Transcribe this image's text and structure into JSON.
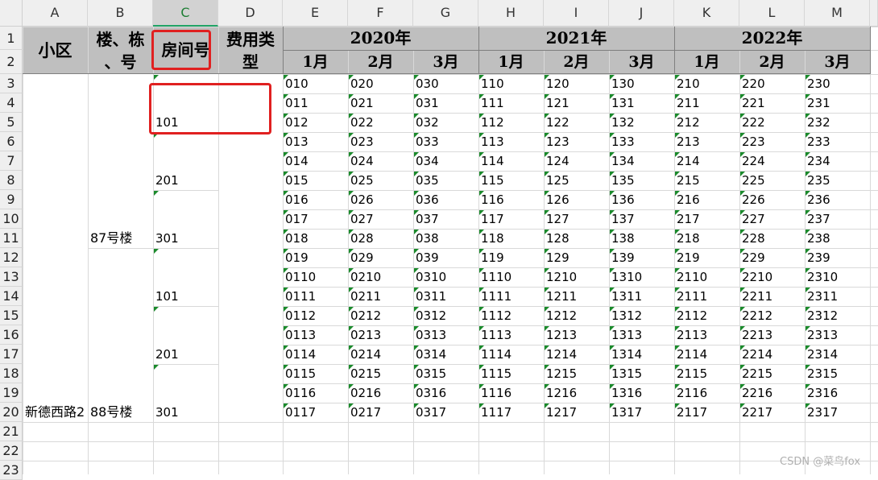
{
  "columns": [
    "A",
    "B",
    "C",
    "D",
    "E",
    "F",
    "G",
    "H",
    "I",
    "J",
    "K",
    "L",
    "M"
  ],
  "selected_column": "C",
  "rows": [
    "1",
    "2",
    "3",
    "4",
    "5",
    "6",
    "7",
    "8",
    "9",
    "10",
    "11",
    "12",
    "13",
    "14",
    "15",
    "16",
    "17",
    "18",
    "19",
    "20",
    "21",
    "22",
    "23"
  ],
  "header": {
    "community": "小区",
    "building_line1": "楼、栋",
    "building_line2": "、号",
    "room": "房间号",
    "fee_line1": "费用类",
    "fee_line2": "型",
    "years": [
      "2020年",
      "2021年",
      "2022年"
    ],
    "months": [
      "1月",
      "2月",
      "3月",
      "1月",
      "2月",
      "3月",
      "1月",
      "2月",
      "3月"
    ]
  },
  "side": {
    "community_value": "新德西路2",
    "buildings": [
      "87号楼",
      "88号楼"
    ],
    "rooms": [
      "101",
      "201",
      "301",
      "101",
      "201",
      "301"
    ]
  },
  "data": [
    [
      "010",
      "020",
      "030",
      "110",
      "120",
      "130",
      "210",
      "220",
      "230"
    ],
    [
      "011",
      "021",
      "031",
      "111",
      "121",
      "131",
      "211",
      "221",
      "231"
    ],
    [
      "012",
      "022",
      "032",
      "112",
      "122",
      "132",
      "212",
      "222",
      "232"
    ],
    [
      "013",
      "023",
      "033",
      "113",
      "123",
      "133",
      "213",
      "223",
      "233"
    ],
    [
      "014",
      "024",
      "034",
      "114",
      "124",
      "134",
      "214",
      "224",
      "234"
    ],
    [
      "015",
      "025",
      "035",
      "115",
      "125",
      "135",
      "215",
      "225",
      "235"
    ],
    [
      "016",
      "026",
      "036",
      "116",
      "126",
      "136",
      "216",
      "226",
      "236"
    ],
    [
      "017",
      "027",
      "037",
      "117",
      "127",
      "137",
      "217",
      "227",
      "237"
    ],
    [
      "018",
      "028",
      "038",
      "118",
      "128",
      "138",
      "218",
      "228",
      "238"
    ],
    [
      "019",
      "029",
      "039",
      "119",
      "129",
      "139",
      "219",
      "229",
      "239"
    ],
    [
      "0110",
      "0210",
      "0310",
      "1110",
      "1210",
      "1310",
      "2110",
      "2210",
      "2310"
    ],
    [
      "0111",
      "0211",
      "0311",
      "1111",
      "1211",
      "1311",
      "2111",
      "2211",
      "2311"
    ],
    [
      "0112",
      "0212",
      "0312",
      "1112",
      "1212",
      "1312",
      "2112",
      "2212",
      "2312"
    ],
    [
      "0113",
      "0213",
      "0313",
      "1113",
      "1213",
      "1313",
      "2113",
      "2213",
      "2313"
    ],
    [
      "0114",
      "0214",
      "0314",
      "1114",
      "1214",
      "1314",
      "2114",
      "2214",
      "2314"
    ],
    [
      "0115",
      "0215",
      "0315",
      "1115",
      "1215",
      "1315",
      "2115",
      "2215",
      "2315"
    ],
    [
      "0116",
      "0216",
      "0316",
      "1116",
      "1216",
      "1316",
      "2116",
      "2216",
      "2316"
    ],
    [
      "0117",
      "0217",
      "0317",
      "1117",
      "1217",
      "1317",
      "2117",
      "2217",
      "2317"
    ]
  ],
  "watermark": "CSDN @菜鸟fox",
  "colors": {
    "header_fill": "#bfbfbf",
    "highlight": "#e02020",
    "comment_marker": "#1a8a2b",
    "selected_col_text": "#1e7e34"
  }
}
